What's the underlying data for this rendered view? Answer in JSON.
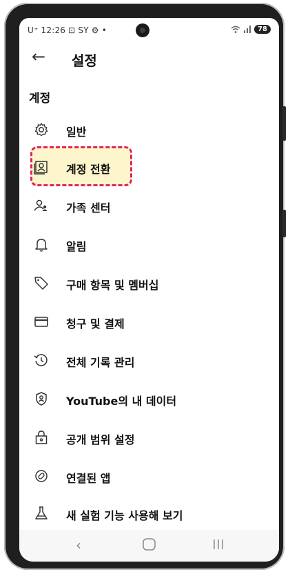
{
  "status_bar": {
    "left_text": "U⁺ 12:26 ⊡ SY ⚙ •",
    "battery": "78"
  },
  "header": {
    "title": "설정"
  },
  "section_label": "계정",
  "menu": [
    {
      "label": "일반",
      "icon": "gear-icon"
    },
    {
      "label": "계정 전환",
      "icon": "account-switch-icon"
    },
    {
      "label": "가족 센터",
      "icon": "family-icon"
    },
    {
      "label": "알림",
      "icon": "bell-icon"
    },
    {
      "label": "구매 항목 및 멤버십",
      "icon": "tag-icon"
    },
    {
      "label": "청구 및 결제",
      "icon": "credit-card-icon"
    },
    {
      "label": "전체 기록 관리",
      "icon": "history-icon"
    },
    {
      "label": "YouTube의 내 데이터",
      "icon": "shield-person-icon"
    },
    {
      "label": "공개 범위 설정",
      "icon": "lock-icon"
    },
    {
      "label": "연결된 앱",
      "icon": "linked-apps-icon"
    },
    {
      "label": "새 실험 기능 사용해 보기",
      "icon": "flask-icon"
    }
  ],
  "highlight_color": "#e0245e"
}
